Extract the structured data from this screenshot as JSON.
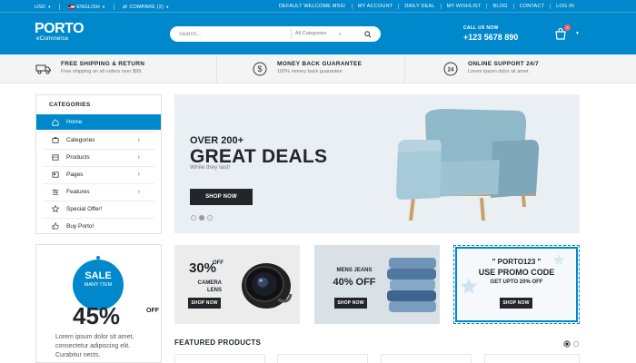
{
  "topbar": {
    "currency": "USD",
    "language": "ENGLISH",
    "compare": "COMPARE (2)",
    "links": [
      "DEFAULT WELCOME MSG!",
      "MY ACCOUNT",
      "DAILY DEAL",
      "MY WISHLIST",
      "BLOG",
      "CONTACT",
      "LOG IN"
    ]
  },
  "header": {
    "logo_main": "PORTO",
    "logo_sub": "eCommerce",
    "search_placeholder": "Search...",
    "category_select": "All Categories",
    "call_label": "CALL US NOW",
    "phone": "+123 5678 890",
    "cart_count": "3"
  },
  "info": [
    {
      "title": "FREE SHIPPING & RETURN",
      "sub": "Free shipping on all orders over $99.",
      "icon": "truck-icon"
    },
    {
      "title": "MONEY BACK GUARANTEE",
      "sub": "100% money back guarantee",
      "icon": "dollar-icon"
    },
    {
      "title": "ONLINE SUPPORT 24/7",
      "sub": "Lorem ipsum dolor sit amet.",
      "icon": "support-24-icon"
    }
  ],
  "sidebar": {
    "title": "CATEGORIES",
    "items": [
      {
        "label": "Home",
        "icon": "home-icon"
      },
      {
        "label": "Categories",
        "icon": "categories-icon"
      },
      {
        "label": "Products",
        "icon": "products-icon"
      },
      {
        "label": "Pages",
        "icon": "pages-icon"
      },
      {
        "label": "Features",
        "icon": "features-icon"
      },
      {
        "label": "Special Offer!",
        "icon": "star-icon"
      },
      {
        "label": "Buy Porto!",
        "icon": "thumbs-up-icon"
      }
    ]
  },
  "sale": {
    "badge_big": "SALE",
    "badge_small": "MANY ITEM",
    "percent": "45%",
    "off": "OFF",
    "text": "Lorem ipsum dolor sit amet, consectetur adipiscing elit. Curabitur nects."
  },
  "hero": {
    "over": "OVER 200+",
    "headline": "GREAT DEALS",
    "sub": "While they last!",
    "button": "SHOP NOW"
  },
  "banners": {
    "b1_pct": "30%",
    "b1_off": "OFF",
    "b1_label": "CAMERA LENS",
    "b1_button": "SHOP NOW",
    "b2_title": "MENS JEANS",
    "b2_off": "40% OFF",
    "b2_button": "SHOP NOW",
    "b3_code": "\" PORTO123 \"",
    "b3_use": "USE PROMO CODE",
    "b3_upto": "GET UPTO 20% OFF",
    "b3_button": "SHOP NOW"
  },
  "featured_title": "FEATURED PRODUCTS",
  "colors": {
    "primary": "#0088cc",
    "dark": "#222529",
    "sale_badge": "#ff5b5b"
  }
}
